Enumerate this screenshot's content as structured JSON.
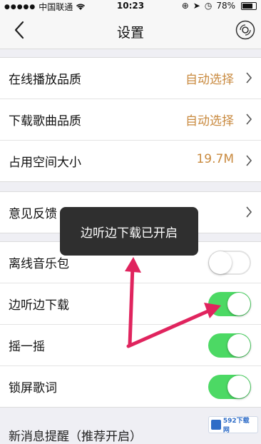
{
  "status_bar": {
    "carrier": "中国联通",
    "time": "10:23",
    "battery": "78%"
  },
  "nav": {
    "title": "设置"
  },
  "quality_group": [
    {
      "label": "在线播放品质",
      "value": "自动选择"
    },
    {
      "label": "下载歌曲品质",
      "value": "自动选择"
    },
    {
      "label": "占用空间大小",
      "value": "19.7M"
    }
  ],
  "feedback": {
    "label": "意见反馈"
  },
  "toggles": [
    {
      "label": "离线音乐包",
      "on": false
    },
    {
      "label": "边听边下载",
      "on": true
    },
    {
      "label": "摇一摇",
      "on": true
    },
    {
      "label": "锁屏歌词",
      "on": true
    }
  ],
  "partial_row": "新消息提醒（推荐开启）",
  "toast": "边听边下载已开启",
  "watermark": "592下载网",
  "colors": {
    "accent_value": "#c98a3f",
    "toggle_on": "#4cd964",
    "arrow": "#e0245e"
  },
  "icons": {
    "back": "chevron-left-icon",
    "disc": "disc-icon",
    "chevron": "chevron-right-icon"
  }
}
